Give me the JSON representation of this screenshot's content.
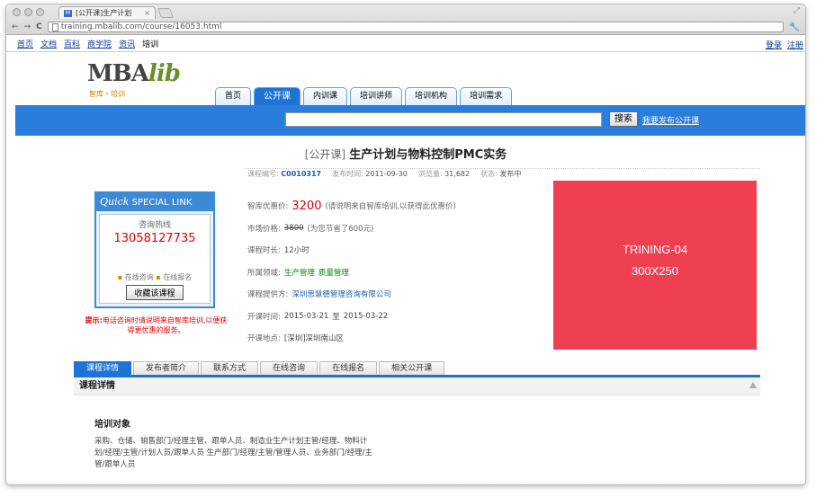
{
  "browser": {
    "tab_title": "[公开课]生产计划",
    "tab_close": "×",
    "fav_label": "M",
    "url": "training.mbalib.com/course/16053.html",
    "back": "←",
    "forward": "→",
    "reload": "C",
    "wrench": "🔧",
    "resize": "⤢"
  },
  "topnav": {
    "items": [
      "首页",
      "文档",
      "百科",
      "商学院",
      "资讯"
    ],
    "current": "培训",
    "right": [
      "登录",
      "注册"
    ]
  },
  "logo": {
    "main": "MBA",
    "accent": "lib",
    "sub": "智库・培训"
  },
  "mainnav": {
    "items": [
      "首页",
      "公开课",
      "内训课",
      "培训讲师",
      "培训机构",
      "培训需求"
    ],
    "active_index": 1
  },
  "search": {
    "value": "",
    "button": "搜索",
    "link": "我要发布公开课"
  },
  "course": {
    "tag": "[公开课]",
    "title": "生产计划与物料控制PMC实务",
    "meta": {
      "code_label": "课程编号:",
      "code": "C0010317",
      "date_label": "发布时间:",
      "date": "2011-09-30",
      "views_label": "浏览量:",
      "views": "31,682",
      "status_label": "状态:",
      "status": "发布中"
    }
  },
  "quick": {
    "head_italic": "Quick",
    "head_text": "SPECIAL LINK",
    "hotline_label": "咨询热线",
    "phone": "13058127735",
    "link1": "在线咨询",
    "link2": "在线报名",
    "bullet": "▪",
    "collect_button": "收藏该课程"
  },
  "tip": {
    "label": "提示:",
    "text": "电话咨询时请说明来自智库培训,以便获得更优惠的服务。"
  },
  "info": {
    "price_label": "智库优惠价:",
    "price": "3200",
    "price_note": "(请说明来自智库培训,以获得此优惠价)",
    "market_label": "市场价格:",
    "market_price": "3800",
    "market_note": "(为您节省了600元)",
    "duration_label": "课程时长:",
    "duration": "12小时",
    "field_label": "所属领域:",
    "field1": "生产管理",
    "field2": "质量管理",
    "provider_label": "课程提供方:",
    "provider": "深圳思慧德管理咨询有限公司",
    "time_label": "开课时间:",
    "time_start": "2015-03-21",
    "time_to": "至",
    "time_end": "2015-03-22",
    "place_label": "开课地点:",
    "place": "[深圳]深圳南山区"
  },
  "ad": {
    "line1": "TRINING-04",
    "line2": "300X250"
  },
  "detail_tabs": {
    "items": [
      "课程详情",
      "发布者简介",
      "联系方式",
      "在线咨询",
      "在线报名",
      "相关公开课"
    ],
    "active_index": 0
  },
  "detail": {
    "header": "课程详情",
    "object_title": "培训对象",
    "object_text": "采购、仓储、销售部门/经理主管、跟单人员、制造业生产计划主管/经理、物料计划/经理/主管/计划人员/跟单人员 生产部门/经理/主管/管理人员、业务部门/经理/主管/跟单人员"
  }
}
